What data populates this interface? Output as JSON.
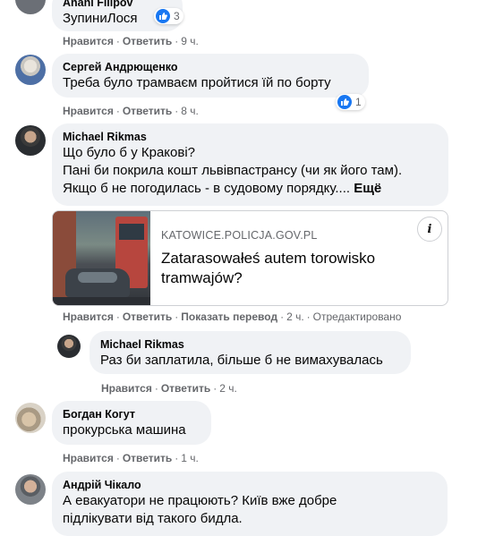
{
  "comments": [
    {
      "author": "Anani Filipov",
      "text": "ЗупиниЛося",
      "reactions": "3",
      "actions": {
        "like": "Нравится",
        "reply": "Ответить",
        "time": "9 ч."
      }
    },
    {
      "author": "Сергей Андрющенко",
      "text": "Треба було трамваєм пройтися їй по борту",
      "reactions": "1",
      "actions": {
        "like": "Нравится",
        "reply": "Ответить",
        "time": "8 ч."
      }
    },
    {
      "author": "Michael Rikmas",
      "lines": [
        "Що було б у Кракові?",
        "Пані би покрила кошт львівпастрансу (чи як його там).",
        "Якщо б не погодилась - в судовому порядку...."
      ],
      "more": "Ещё",
      "link": {
        "domain": "KATOWICE.POLICJA.GOV.PL",
        "title_line1": "Zatarasowałeś autem torowisko",
        "title_line2": "tramwajów?",
        "info": "i"
      },
      "actions": {
        "like": "Нравится",
        "reply": "Ответить",
        "translate": "Показать перевод",
        "time": "2 ч.",
        "edited": "Отредактировано"
      }
    },
    {
      "author": "Michael Rikmas",
      "text": "Раз би заплатила, більше б не вимахувалась",
      "actions": {
        "like": "Нравится",
        "reply": "Ответить",
        "time": "2 ч."
      }
    },
    {
      "author": "Богдан Когут",
      "text": "прокурська машина",
      "actions": {
        "like": "Нравится",
        "reply": "Ответить",
        "time": "1 ч."
      }
    },
    {
      "author": "Андрій Чікало",
      "lines": [
        "А евакуатори не працюють? Київ вже добре",
        "підлікувати від такого бидла."
      ]
    }
  ],
  "colors": {
    "bubble": "#f0f2f5",
    "like_blue": "#1877f2",
    "meta_gray": "#65676b"
  },
  "icons": {
    "reaction": "like-icon",
    "info": "info-icon"
  }
}
